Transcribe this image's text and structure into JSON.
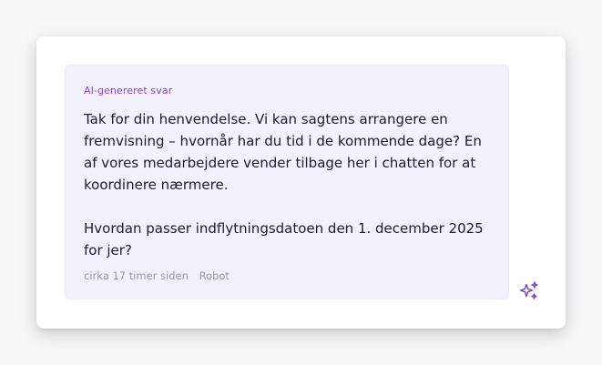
{
  "message": {
    "label": "AI-genereret svar",
    "paragraph_1": "Tak for din henvendelse. Vi kan sagtens arrangere en fremvisning – hvornår har du tid i de kommende dage? En af vores medarbejdere vender tilbage her i chatten for at koordinere nærmere.",
    "paragraph_2": "Hvordan passer indflytningsdatoen den 1. december 2025 for jer?",
    "timestamp": "cirka 17 timer siden",
    "author": "Robot"
  },
  "icons": {
    "ai_indicator": "sparkles-icon"
  },
  "colors": {
    "bubble_background": "#f4f1fe",
    "label_accent": "#8b44c9",
    "icon_accent": "#7a3fc8",
    "meta_text": "#9a98a6"
  }
}
